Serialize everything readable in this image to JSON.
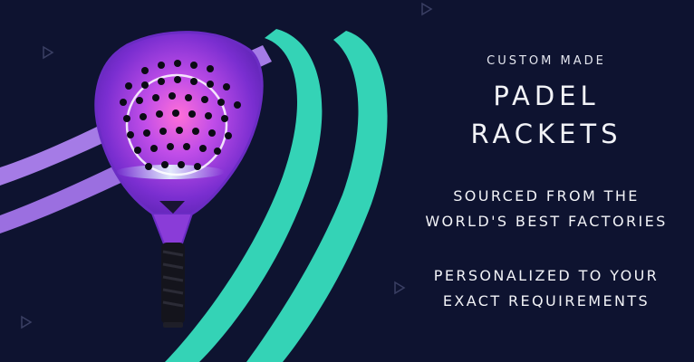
{
  "banner": {
    "eyebrow": "CUSTOM MADE",
    "headline": [
      "PADEL",
      "RACKETS"
    ],
    "tagline_1": [
      "SOURCED FROM THE",
      "WORLD'S BEST FACTORIES"
    ],
    "tagline_2": [
      "PERSONALIZED TO YOUR",
      "EXACT REQUIREMENTS"
    ]
  },
  "colors": {
    "background": "#0e1330",
    "teal_stripe": "#34d3b6",
    "purple_stripe": "#a57be6",
    "racket_purple": "#8a3cd8",
    "text": "#f2f3f7"
  },
  "icons": [
    "play-triangle-icon",
    "play-triangle-icon",
    "play-triangle-icon",
    "play-triangle-icon"
  ]
}
